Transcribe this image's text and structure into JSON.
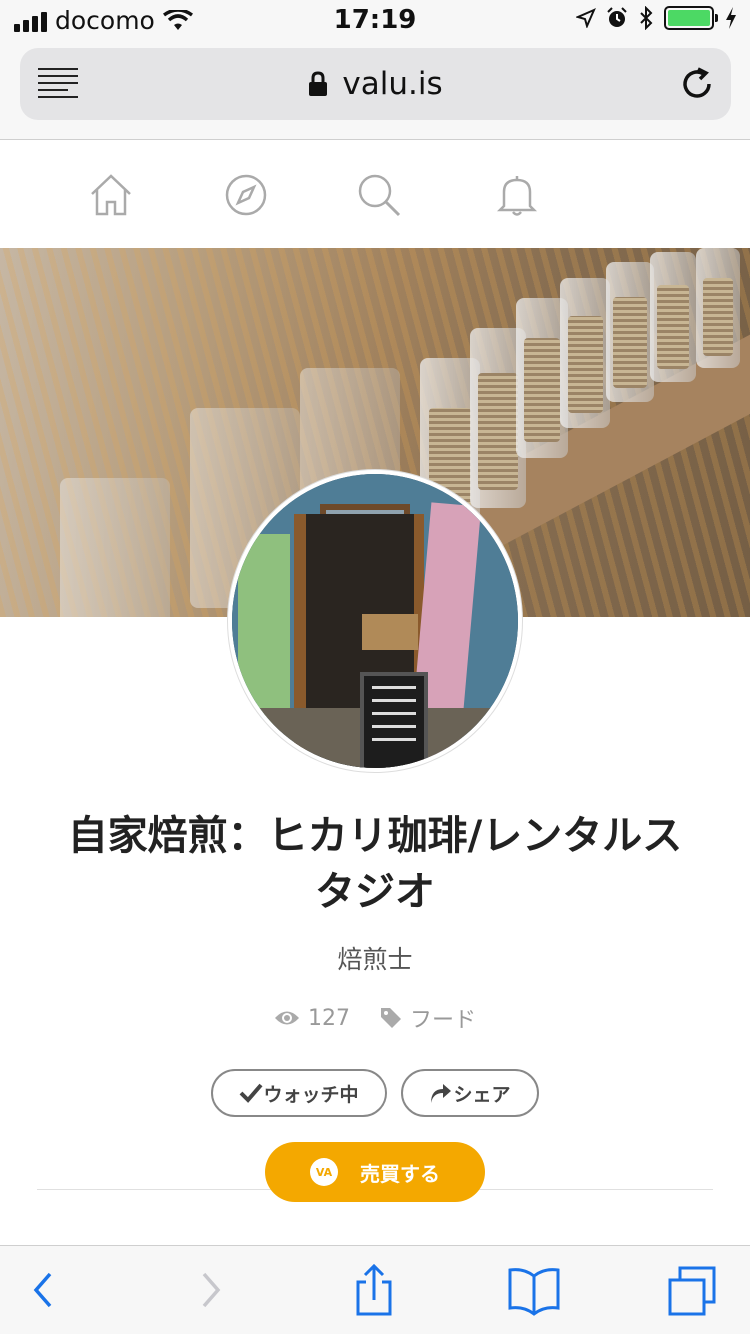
{
  "status_bar": {
    "carrier": "docomo",
    "time": "17:19"
  },
  "browser": {
    "url": "valu.is"
  },
  "profile": {
    "title": "自家焙煎：ヒカリ珈琲/レンタルスタジオ",
    "subtitle": "焙煎士",
    "views": "127",
    "category": "フード",
    "watch_label": "ウォッチ中",
    "share_label": "シェア",
    "buy_label": "売買する",
    "va_badge": "VA"
  },
  "colors": {
    "accent": "#f4a800",
    "ios_blue": "#1a73e8",
    "battery": "#4cd964"
  }
}
